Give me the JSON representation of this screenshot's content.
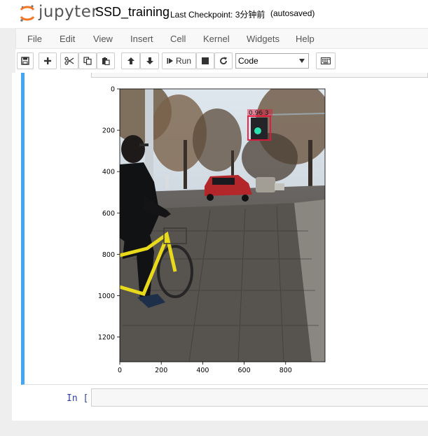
{
  "header": {
    "logo_text": "jupyter",
    "notebook_title": "SSD_training",
    "checkpoint": "Last Checkpoint: 3分钟前",
    "autosave_status": "(autosaved)"
  },
  "menu": {
    "items": [
      "File",
      "Edit",
      "View",
      "Insert",
      "Cell",
      "Kernel",
      "Widgets",
      "Help"
    ]
  },
  "toolbar": {
    "run_label": "Run",
    "cell_type": "Code"
  },
  "output": {
    "detection_label": "0.96 3",
    "chart_data": {
      "type": "image",
      "x_ticks": [
        "0",
        "200",
        "400",
        "600",
        "800"
      ],
      "y_ticks": [
        "0",
        "200",
        "400",
        "600",
        "800",
        "1000",
        "1200"
      ],
      "xlim": [
        0,
        990
      ],
      "ylim": [
        1320,
        0
      ]
    }
  },
  "next_cell": {
    "prompt": "In [ ]:"
  },
  "colors": {
    "selected_cell_border": "#42a5f5",
    "prompt_color": "#303f9f",
    "detection_box": "#e8143a"
  }
}
